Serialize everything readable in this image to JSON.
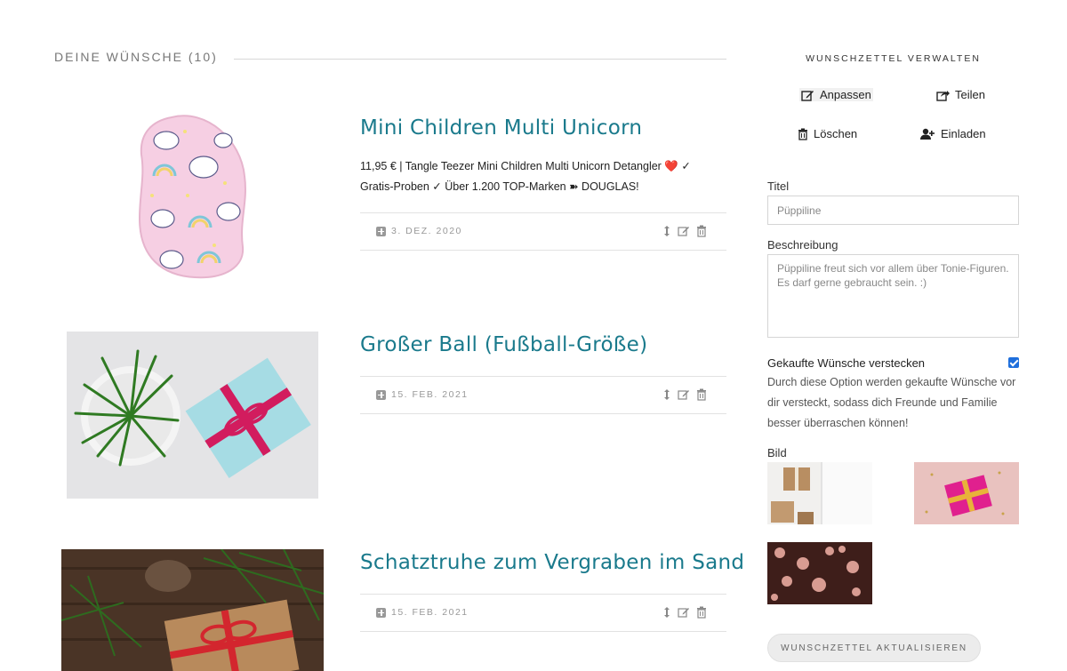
{
  "main": {
    "section_title": "DEINE WÜNSCHE (10)",
    "wishes": [
      {
        "title": "Mini Children Multi Unicorn",
        "description": "11,95 € | Tangle Teezer Mini Children Multi Unicorn Detangler ❤️ ✓ Gratis-Proben ✓ Über 1.200 TOP-Marken ➽ DOUGLAS!",
        "date": "3. DEZ. 2020",
        "image": "unicorn-hairbrush"
      },
      {
        "title": "Großer Ball (Fußball-Größe)",
        "description": "",
        "date": "15. FEB. 2021",
        "image": "plant-and-gift"
      },
      {
        "title": "Schatztruhe zum Vergraben im Sand",
        "description": "",
        "date": "15. FEB. 2021",
        "image": "kraft-gift-with-fir"
      }
    ],
    "action_icons": [
      "move-icon",
      "edit-icon",
      "trash-icon"
    ]
  },
  "sidebar": {
    "title": "WUNSCHZETTEL VERWALTEN",
    "actions": {
      "customize": "Anpassen",
      "share": "Teilen",
      "delete": "Löschen",
      "invite": "Einladen"
    },
    "title_label": "Titel",
    "title_value": "Püppiline",
    "description_label": "Beschreibung",
    "description_value": "Püppiline freut sich vor allem über Tonie-Figuren. Es darf gerne gebraucht sein. :)",
    "hide_purchased_label": "Gekaufte Wünsche verstecken",
    "hide_purchased_checked": true,
    "hide_purchased_help": "Durch diese Option werden gekaufte Wünsche vor dir versteckt, sodass dich Freunde und Familie besser überraschen können!",
    "image_label": "Bild",
    "images": [
      "gift-boxes-white",
      "pink-gift-gold-ribbon",
      "bokeh-hearts"
    ],
    "update_button": "WUNSCHZETTEL AKTUALISIEREN"
  },
  "colors": {
    "accent": "#1a7a8c",
    "checkbox": "#1f6fdc"
  }
}
